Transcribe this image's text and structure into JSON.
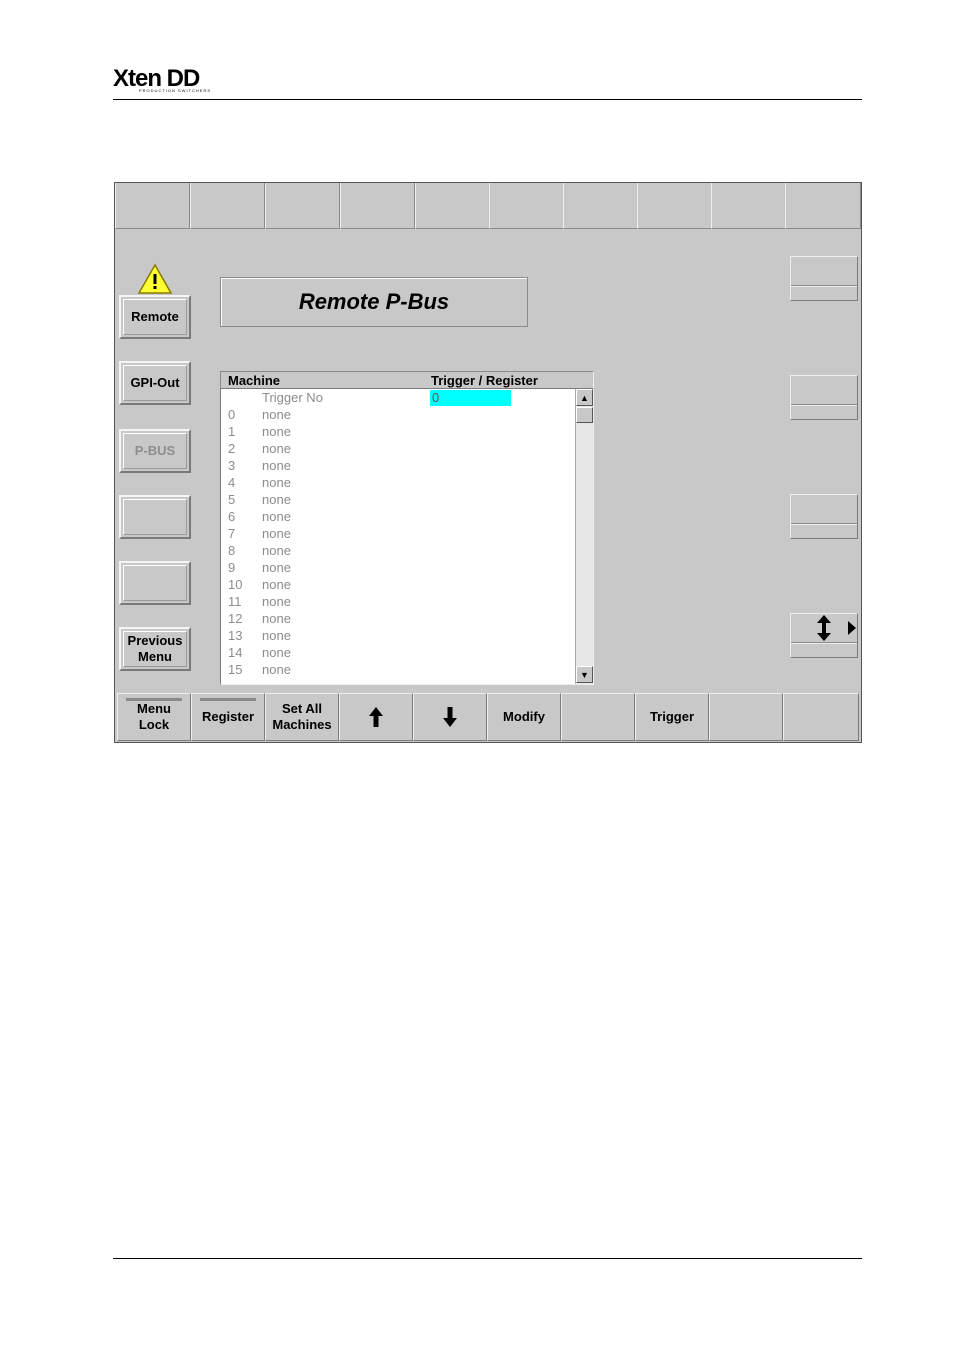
{
  "header": {
    "logo_text": "Xten DD",
    "logo_subtext": "PRODUCTION SWITCHERS"
  },
  "screen": {
    "title": "Remote P-Bus",
    "side_menu": [
      {
        "label": "Remote",
        "state": "normal"
      },
      {
        "label": "GPI-Out",
        "state": "normal"
      },
      {
        "label": "P-BUS",
        "state": "disabled"
      },
      {
        "label": "",
        "state": "empty"
      },
      {
        "label": "",
        "state": "empty"
      },
      {
        "label": "Previous Menu",
        "state": "normal"
      }
    ],
    "table": {
      "columns": [
        "Machine",
        "Trigger / Register"
      ],
      "trigger_row": {
        "label": "Trigger No",
        "value": "0"
      },
      "rows": [
        {
          "index": "0",
          "name": "none"
        },
        {
          "index": "1",
          "name": "none"
        },
        {
          "index": "2",
          "name": "none"
        },
        {
          "index": "3",
          "name": "none"
        },
        {
          "index": "4",
          "name": "none"
        },
        {
          "index": "5",
          "name": "none"
        },
        {
          "index": "6",
          "name": "none"
        },
        {
          "index": "7",
          "name": "none"
        },
        {
          "index": "8",
          "name": "none"
        },
        {
          "index": "9",
          "name": "none"
        },
        {
          "index": "10",
          "name": "none"
        },
        {
          "index": "11",
          "name": "none"
        },
        {
          "index": "12",
          "name": "none"
        },
        {
          "index": "13",
          "name": "none"
        },
        {
          "index": "14",
          "name": "none"
        },
        {
          "index": "15",
          "name": "none"
        }
      ]
    },
    "bottom_keys": [
      {
        "label": "Menu\nLock",
        "bar": true
      },
      {
        "label": "Register",
        "bar": true
      },
      {
        "label": "Set All\nMachines",
        "bar": false
      },
      {
        "label": "↑",
        "bar": false,
        "icon": "arrow-up-icon"
      },
      {
        "label": "↓",
        "bar": false,
        "icon": "arrow-down-icon"
      },
      {
        "label": "Modify",
        "bar": false
      },
      {
        "label": "",
        "bar": false
      },
      {
        "label": "Trigger",
        "bar": false
      },
      {
        "label": "",
        "bar": false
      },
      {
        "label": "",
        "bar": false
      }
    ],
    "scroll_buttons": {
      "up": "▲",
      "down": "▼"
    },
    "right_panel_icon": "vertical-resize-icon",
    "colors": {
      "background": "#c8c8c8",
      "selection": "#00ffff",
      "disabled_text": "#8c8c8c"
    }
  }
}
